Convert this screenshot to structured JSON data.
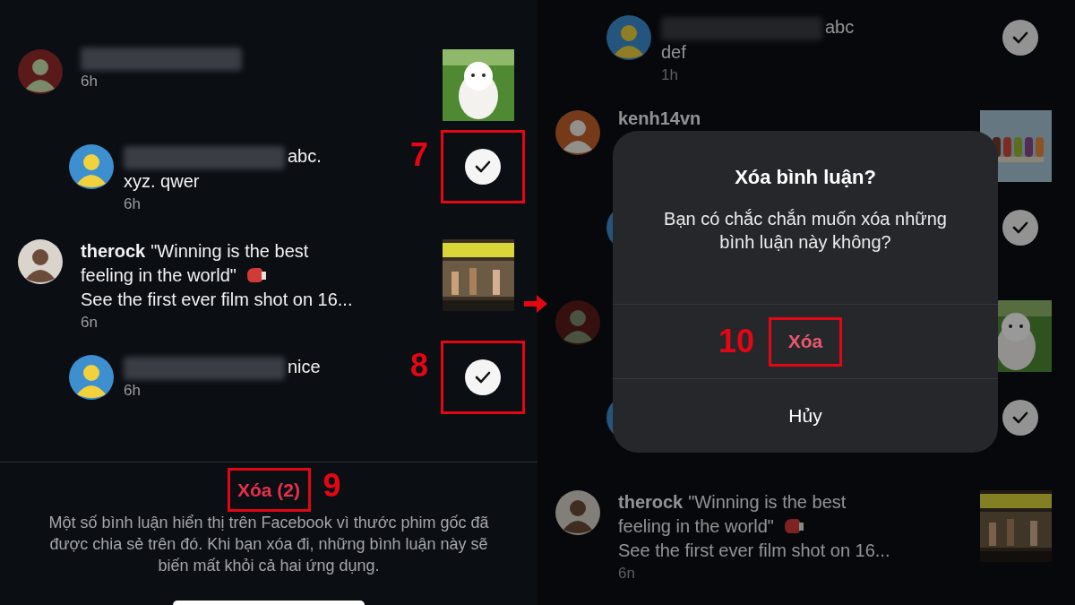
{
  "panels": [
    {
      "dimmed": false,
      "comments": [
        {
          "kind": "post",
          "avatar": {
            "kind": "ninja"
          },
          "name_blurred": true,
          "time": "6h",
          "thumbnail": {
            "kind": "dog"
          }
        },
        {
          "kind": "reply",
          "avatar": {
            "kind": "duck"
          },
          "name_blurred": true,
          "lines": [
            {
              "text": "abc."
            },
            {
              "text": "xyz. qwer"
            }
          ],
          "time": "6h",
          "selected": true,
          "callout": "7"
        },
        {
          "kind": "post",
          "avatar": {
            "kind": "person"
          },
          "username": "therock",
          "lines": [
            {
              "text": "\"Winning is the best"
            },
            {
              "text": "feeling in the world\"",
              "glove": true
            },
            {
              "text": "See the first ever film shot on 16..."
            }
          ],
          "time": "6n",
          "thumbnail": {
            "kind": "poster"
          }
        },
        {
          "kind": "reply",
          "avatar": {
            "kind": "duck"
          },
          "name_blurred": true,
          "lines": [
            {
              "text": "nice"
            }
          ],
          "time": "6h",
          "selected": true,
          "callout": "8"
        }
      ],
      "footer": {
        "button": {
          "label": "Xóa (2)",
          "callout": "9"
        },
        "note": "Một số bình luận hiển thị trên Facebook vì thước phim gốc đã được chia sẻ trên đó. Khi bạn xóa đi, những bình luận này sẽ biến mất khỏi cả hai ứng dụng."
      }
    },
    {
      "dimmed": true,
      "comments": [
        {
          "kind": "reply",
          "avatar": {
            "kind": "duck"
          },
          "name_blurred": true,
          "lines": [
            {
              "text": "abc"
            },
            {
              "text": "def"
            }
          ],
          "time": "1h",
          "selected": true
        },
        {
          "kind": "post",
          "avatar": {
            "kind": "logo"
          },
          "username": "kenh14vn",
          "thumbnail": {
            "kind": "popsicles"
          }
        },
        {
          "kind": "reply",
          "avatar": {
            "kind": "duck"
          },
          "selected": true
        },
        {
          "kind": "post",
          "avatar": {
            "kind": "ninja"
          },
          "thumbnail": {
            "kind": "dog"
          }
        },
        {
          "kind": "reply",
          "avatar": {
            "kind": "duck"
          },
          "selected": true
        },
        {
          "kind": "post",
          "avatar": {
            "kind": "person"
          },
          "username": "therock",
          "lines": [
            {
              "text": "\"Winning is the best"
            },
            {
              "text": "feeling in the world\"",
              "glove": true
            },
            {
              "text": "See the first ever film shot on 16..."
            }
          ],
          "time": "6n",
          "thumbnail": {
            "kind": "poster"
          }
        }
      ],
      "dialog": {
        "title": "Xóa bình luận?",
        "message": "Bạn có chắc chắn muốn xóa những bình luận này không?",
        "confirm": {
          "label": "Xóa",
          "callout": "10"
        },
        "cancel": "Hủy"
      }
    }
  ]
}
